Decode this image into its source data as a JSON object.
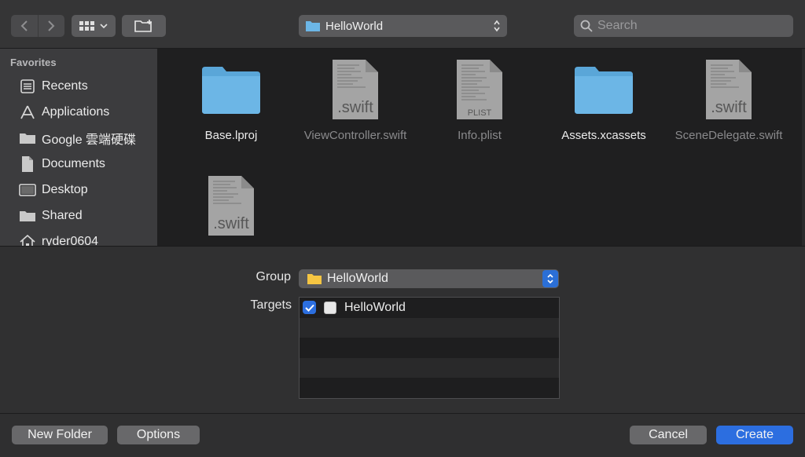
{
  "toolbar": {
    "back_icon": "chevron-left-icon",
    "forward_icon": "chevron-right-icon",
    "view_icon": "grid-view-icon",
    "new_folder_icon": "folder-add-icon",
    "location_label": "HelloWorld",
    "search_placeholder": "Search"
  },
  "sidebar": {
    "heading": "Favorites",
    "items": [
      {
        "label": "Recents",
        "icon": "clock-list-icon"
      },
      {
        "label": "Applications",
        "icon": "applications-icon"
      },
      {
        "label": "Google 雲端硬碟",
        "icon": "drive-folder-icon"
      },
      {
        "label": "Documents",
        "icon": "document-icon"
      },
      {
        "label": "Desktop",
        "icon": "desktop-icon"
      },
      {
        "label": "Shared",
        "icon": "shared-folder-icon"
      },
      {
        "label": "ryder0604",
        "icon": "home-icon"
      }
    ]
  },
  "files": [
    {
      "name": "Base.lproj",
      "kind": "folder",
      "enabled": true
    },
    {
      "name": "ViewController.swift",
      "kind": "swift",
      "ext": ".swift",
      "enabled": false
    },
    {
      "name": "Info.plist",
      "kind": "plist",
      "ext": "PLIST",
      "enabled": false
    },
    {
      "name": "Assets.xcassets",
      "kind": "folder",
      "enabled": true
    },
    {
      "name": "SceneDelegate.swift",
      "kind": "swift",
      "ext": ".swift",
      "enabled": false
    },
    {
      "name": "",
      "kind": "swift",
      "ext": ".swift",
      "enabled": false
    }
  ],
  "options": {
    "group_label": "Group",
    "group_value": "HelloWorld",
    "targets_label": "Targets",
    "targets": [
      {
        "name": "HelloWorld",
        "checked": true
      }
    ]
  },
  "buttons": {
    "new_folder": "New Folder",
    "options": "Options",
    "cancel": "Cancel",
    "create": "Create"
  },
  "colors": {
    "accent": "#2c6ee0",
    "folder_blue": "#6cb6e6",
    "folder_yellow": "#f5c542"
  }
}
